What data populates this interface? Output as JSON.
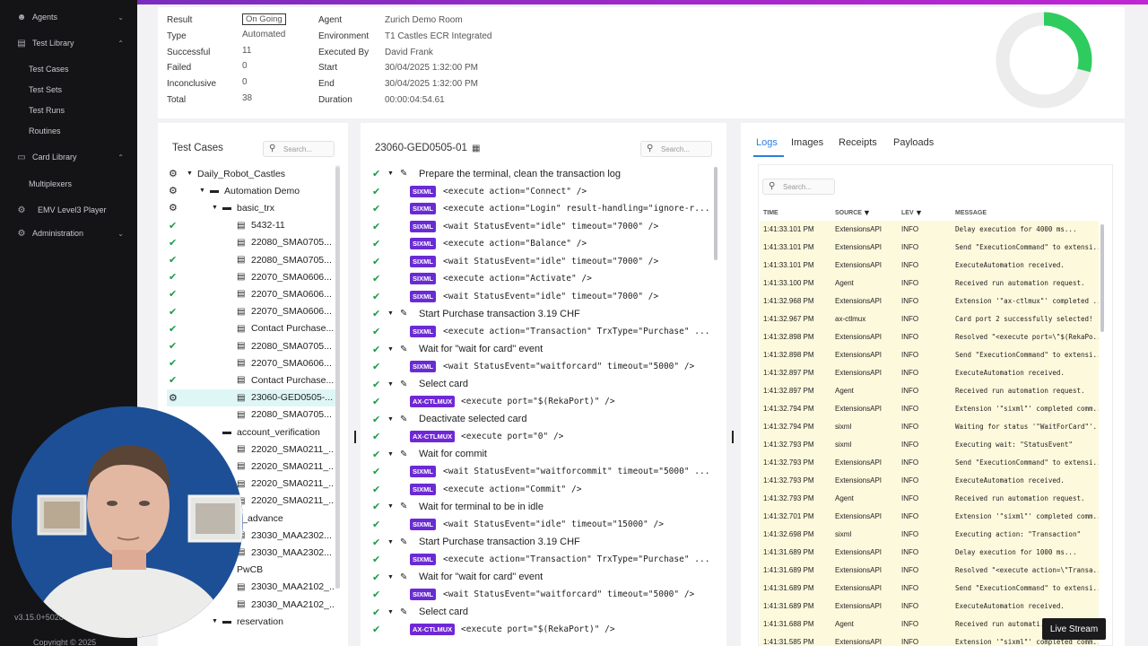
{
  "sidebar": {
    "items": [
      {
        "label": "Agents",
        "icon": "user-icon",
        "chevron": "⌄"
      },
      {
        "label": "Test Library",
        "icon": "library-icon",
        "chevron": "⌃"
      },
      {
        "label": "Test Cases"
      },
      {
        "label": "Test Sets"
      },
      {
        "label": "Test Runs"
      },
      {
        "label": "Routines"
      },
      {
        "label": "Card Library",
        "icon": "card-icon",
        "chevron": "⌃"
      },
      {
        "label": "Multiplexers"
      },
      {
        "label": "EMV Level3 Player",
        "icon": "robot-icon"
      },
      {
        "label": "Administration",
        "icon": "gear-icon",
        "chevron": "⌄"
      }
    ],
    "version": "v3.15.0+5028",
    "copyright": "Copyright © 2025"
  },
  "summary": {
    "left": [
      {
        "k": "Result",
        "v": "On Going"
      },
      {
        "k": "Type",
        "v": "Automated"
      },
      {
        "k": "Successful",
        "v": "11"
      },
      {
        "k": "Failed",
        "v": "0"
      },
      {
        "k": "Inconclusive",
        "v": "0"
      },
      {
        "k": "Total",
        "v": "38"
      }
    ],
    "right": [
      {
        "k": "Agent",
        "v": "Zurich Demo Room"
      },
      {
        "k": "Environment",
        "v": "T1 Castles ECR Integrated"
      },
      {
        "k": "Executed By",
        "v": "David Frank"
      },
      {
        "k": "Start",
        "v": "30/04/2025 1:32:00 PM"
      },
      {
        "k": "End",
        "v": "30/04/2025 1:32:00 PM"
      },
      {
        "k": "Duration",
        "v": "00:00:04:54.61"
      }
    ],
    "progress_fraction": 0.29,
    "colors": {
      "progress": "#2ecc5e",
      "track": "#ececec"
    }
  },
  "test_cases": {
    "title": "Test Cases",
    "search_placeholder": "Search...",
    "rows": [
      {
        "status": "gear",
        "caret": "▼",
        "icon": "",
        "label": "Daily_Robot_Castles",
        "depth": 0
      },
      {
        "status": "gear",
        "caret": "▼",
        "icon": "folder",
        "label": "Automation Demo",
        "depth": 1
      },
      {
        "status": "gear",
        "caret": "▼",
        "icon": "folder",
        "label": "basic_trx",
        "depth": 2
      },
      {
        "status": "ok",
        "caret": "",
        "icon": "doc",
        "label": "5432-11",
        "depth": 3
      },
      {
        "status": "ok",
        "caret": "",
        "icon": "doc",
        "label": "22080_SMA0705...",
        "depth": 3
      },
      {
        "status": "ok",
        "caret": "",
        "icon": "doc",
        "label": "22080_SMA0705...",
        "depth": 3
      },
      {
        "status": "ok",
        "caret": "",
        "icon": "doc",
        "label": "22070_SMA0606...",
        "depth": 3
      },
      {
        "status": "ok",
        "caret": "",
        "icon": "doc",
        "label": "22070_SMA0606...",
        "depth": 3
      },
      {
        "status": "ok",
        "caret": "",
        "icon": "doc",
        "label": "22070_SMA0606...",
        "depth": 3
      },
      {
        "status": "ok",
        "caret": "",
        "icon": "doc",
        "label": "Contact Purchase...",
        "depth": 3
      },
      {
        "status": "ok",
        "caret": "",
        "icon": "doc",
        "label": "22080_SMA0705...",
        "depth": 3
      },
      {
        "status": "ok",
        "caret": "",
        "icon": "doc",
        "label": "22070_SMA0606...",
        "depth": 3
      },
      {
        "status": "ok",
        "caret": "",
        "icon": "doc",
        "label": "Contact Purchase...",
        "depth": 3
      },
      {
        "status": "gear",
        "caret": "",
        "icon": "doc",
        "label": "23060-GED0505-...",
        "depth": 3,
        "selected": true
      },
      {
        "status": "",
        "caret": "",
        "icon": "doc",
        "label": "22080_SMA0705...",
        "depth": 3
      },
      {
        "status": "",
        "caret": "",
        "icon": "folder",
        "label": "account_verification",
        "depth": 2
      },
      {
        "status": "",
        "caret": "",
        "icon": "doc",
        "label": "22020_SMA0211_...",
        "depth": 3
      },
      {
        "status": "",
        "caret": "",
        "icon": "doc",
        "label": "22020_SMA0211_...",
        "depth": 3
      },
      {
        "status": "",
        "caret": "",
        "icon": "doc",
        "label": "22020_SMA0211_...",
        "depth": 3
      },
      {
        "status": "",
        "caret": "",
        "icon": "doc",
        "label": "22020_SMA0211_...",
        "depth": 3
      },
      {
        "status": "",
        "caret": "",
        "icon": "",
        "label": "cash_advance",
        "depth": 2
      },
      {
        "status": "",
        "caret": "",
        "icon": "doc",
        "label": "23030_MAA2302...",
        "depth": 3
      },
      {
        "status": "",
        "caret": "",
        "icon": "doc",
        "label": "23030_MAA2302...",
        "depth": 3
      },
      {
        "status": "",
        "caret": "",
        "icon": "folder",
        "label": "PwCB",
        "depth": 2
      },
      {
        "status": "",
        "caret": "",
        "icon": "doc",
        "label": "23030_MAA2102_...",
        "depth": 3
      },
      {
        "status": "",
        "caret": "",
        "icon": "doc",
        "label": "23030_MAA2102_...",
        "depth": 3
      },
      {
        "status": "clock",
        "caret": "▼",
        "icon": "folder",
        "label": "reservation",
        "depth": 2
      }
    ]
  },
  "steps": {
    "title": "23060-GED0505-01",
    "search_placeholder": "Search...",
    "rows": [
      {
        "kind": "group",
        "text": "Prepare the terminal, clean the transaction log"
      },
      {
        "kind": "cmd",
        "tag": "SIXML",
        "text": "<execute action=\"Connect\" />"
      },
      {
        "kind": "cmd",
        "tag": "SIXML",
        "text": "<execute action=\"Login\" result-handling=\"ignore-r..."
      },
      {
        "kind": "cmd",
        "tag": "SIXML",
        "text": "<wait StatusEvent=\"idle\" timeout=\"7000\" />"
      },
      {
        "kind": "cmd",
        "tag": "SIXML",
        "text": "<execute action=\"Balance\" />"
      },
      {
        "kind": "cmd",
        "tag": "SIXML",
        "text": "<wait StatusEvent=\"idle\" timeout=\"7000\" />"
      },
      {
        "kind": "cmd",
        "tag": "SIXML",
        "text": "<execute action=\"Activate\" />"
      },
      {
        "kind": "cmd",
        "tag": "SIXML",
        "text": "<wait StatusEvent=\"idle\" timeout=\"7000\" />"
      },
      {
        "kind": "group",
        "text": "Start Purchase transaction 3.19 CHF"
      },
      {
        "kind": "cmd",
        "tag": "SIXML",
        "text": "<execute action=\"Transaction\" TrxType=\"Purchase\" ..."
      },
      {
        "kind": "group",
        "text": "Wait for \"wait for card\" event"
      },
      {
        "kind": "cmd",
        "tag": "SIXML",
        "text": "<wait StatusEvent=\"waitforcard\" timeout=\"5000\" />"
      },
      {
        "kind": "group",
        "text": "Select card"
      },
      {
        "kind": "cmd",
        "tag": "AX-CTLMUX",
        "text": "<execute port=\"$(RekaPort)\" />"
      },
      {
        "kind": "group",
        "text": "Deactivate selected card"
      },
      {
        "kind": "cmd",
        "tag": "AX-CTLMUX",
        "text": "<execute port=\"0\" />"
      },
      {
        "kind": "group",
        "text": "Wait for commit"
      },
      {
        "kind": "cmd",
        "tag": "SIXML",
        "text": "<wait StatusEvent=\"waitforcommit\" timeout=\"5000\" ..."
      },
      {
        "kind": "cmd",
        "tag": "SIXML",
        "text": "<execute action=\"Commit\" />"
      },
      {
        "kind": "group",
        "text": "Wait for terminal to be in idle"
      },
      {
        "kind": "cmd",
        "tag": "SIXML",
        "text": "<wait StatusEvent=\"idle\" timeout=\"15000\" />"
      },
      {
        "kind": "group",
        "text": "Start Purchase transaction 3.19 CHF"
      },
      {
        "kind": "cmd",
        "tag": "SIXML",
        "text": "<execute action=\"Transaction\" TrxType=\"Purchase\" ..."
      },
      {
        "kind": "group",
        "text": "Wait for \"wait for card\" event"
      },
      {
        "kind": "cmd",
        "tag": "SIXML",
        "text": "<wait StatusEvent=\"waitforcard\" timeout=\"5000\" />"
      },
      {
        "kind": "group",
        "text": "Select card"
      },
      {
        "kind": "cmd",
        "tag": "AX-CTLMUX",
        "text": "<execute port=\"$(RekaPort)\" />"
      }
    ]
  },
  "logs": {
    "tabs": [
      "Logs",
      "Images",
      "Receipts",
      "Payloads"
    ],
    "search_placeholder": "Search...",
    "columns": [
      "TIME",
      "SOURCE",
      "LEV",
      "MESSAGE"
    ],
    "rows": [
      [
        "1:41:33.101 PM",
        "ExtensionsAPI",
        "INFO",
        "Delay execution for 4000 ms..."
      ],
      [
        "1:41:33.101 PM",
        "ExtensionsAPI",
        "INFO",
        "Send \"ExecutionCommand\" to extensi..."
      ],
      [
        "1:41:33.101 PM",
        "ExtensionsAPI",
        "INFO",
        "ExecuteAutomation received."
      ],
      [
        "1:41:33.100 PM",
        "Agent",
        "INFO",
        "Received run automation request."
      ],
      [
        "1:41:32.968 PM",
        "ExtensionsAPI",
        "INFO",
        "Extension '\"ax-ctlmux\"' completed ..."
      ],
      [
        "1:41:32.967 PM",
        "ax-ctlmux",
        "INFO",
        "Card port 2 successfully selected!"
      ],
      [
        "1:41:32.898 PM",
        "ExtensionsAPI",
        "INFO",
        "Resolved \"<execute port=\\\"$(RekaPo..."
      ],
      [
        "1:41:32.898 PM",
        "ExtensionsAPI",
        "INFO",
        "Send \"ExecutionCommand\" to extensi..."
      ],
      [
        "1:41:32.897 PM",
        "ExtensionsAPI",
        "INFO",
        "ExecuteAutomation received."
      ],
      [
        "1:41:32.897 PM",
        "Agent",
        "INFO",
        "Received run automation request."
      ],
      [
        "1:41:32.794 PM",
        "ExtensionsAPI",
        "INFO",
        "Extension '\"sixml\"' completed comm..."
      ],
      [
        "1:41:32.794 PM",
        "sixml",
        "INFO",
        "Waiting for status '\"WaitForCard\"'."
      ],
      [
        "1:41:32.793 PM",
        "sixml",
        "INFO",
        "Executing wait: \"StatusEvent\""
      ],
      [
        "1:41:32.793 PM",
        "ExtensionsAPI",
        "INFO",
        "Send \"ExecutionCommand\" to extensi..."
      ],
      [
        "1:41:32.793 PM",
        "ExtensionsAPI",
        "INFO",
        "ExecuteAutomation received."
      ],
      [
        "1:41:32.793 PM",
        "Agent",
        "INFO",
        "Received run automation request."
      ],
      [
        "1:41:32.701 PM",
        "ExtensionsAPI",
        "INFO",
        "Extension '\"sixml\"' completed comm..."
      ],
      [
        "1:41:32.698 PM",
        "sixml",
        "INFO",
        "Executing action: \"Transaction\""
      ],
      [
        "1:41:31.689 PM",
        "ExtensionsAPI",
        "INFO",
        "Delay execution for 1000 ms..."
      ],
      [
        "1:41:31.689 PM",
        "ExtensionsAPI",
        "INFO",
        "Resolved \"<execute action=\\\"Transa..."
      ],
      [
        "1:41:31.689 PM",
        "ExtensionsAPI",
        "INFO",
        "Send \"ExecutionCommand\" to extensi..."
      ],
      [
        "1:41:31.689 PM",
        "ExtensionsAPI",
        "INFO",
        "ExecuteAutomation received."
      ],
      [
        "1:41:31.688 PM",
        "Agent",
        "INFO",
        "Received run automati..."
      ],
      [
        "1:41:31.585 PM",
        "ExtensionsAPI",
        "INFO",
        "Extension '\"sixml\"' completed comm..."
      ]
    ]
  },
  "live_stream_label": "Live Stream"
}
